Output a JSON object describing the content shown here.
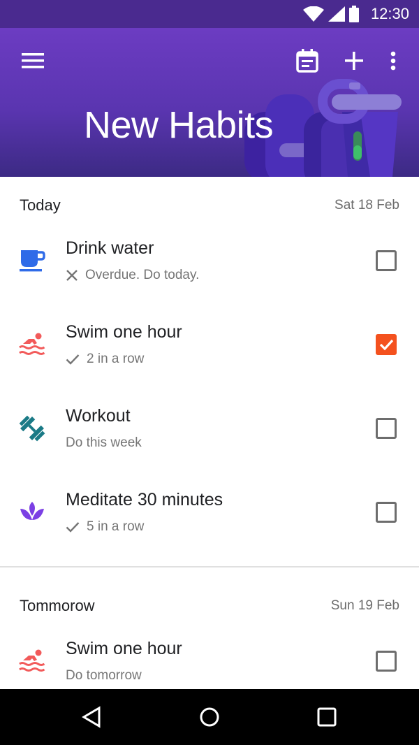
{
  "status_bar": {
    "time": "12:30"
  },
  "header": {
    "title": "New Habits",
    "icons": [
      "menu-icon",
      "calendar-icon",
      "add-icon",
      "more-vert-icon"
    ]
  },
  "sections": [
    {
      "label": "Today",
      "date": "Sat 18 Feb",
      "items": [
        {
          "name": "Drink water",
          "status": "Overdue. Do today.",
          "status_icon": "close",
          "checked": false,
          "icon": "coffee-cup-icon",
          "icon_color": "#2f6be8"
        },
        {
          "name": "Swim one hour",
          "status": "2 in a row",
          "status_icon": "check",
          "checked": true,
          "icon": "swimmer-icon",
          "icon_color": "#f25a5a"
        },
        {
          "name": "Workout",
          "status": "Do this week",
          "status_icon": "",
          "checked": false,
          "icon": "dumbbell-icon",
          "icon_color": "#1a7a86"
        },
        {
          "name": "Meditate 30 minutes",
          "status": "5 in a row",
          "status_icon": "check",
          "checked": false,
          "icon": "lotus-icon",
          "icon_color": "#7b3fe4"
        }
      ]
    },
    {
      "label": "Tommorow",
      "date": "Sun 19 Feb",
      "items": [
        {
          "name": "Swim one hour",
          "status": "Do tomorrow",
          "status_icon": "",
          "checked": false,
          "icon": "swimmer-icon",
          "icon_color": "#f25a5a"
        }
      ]
    }
  ],
  "colors": {
    "accent": "#f4511e",
    "header": "#5a35b0",
    "statusbar": "#4a2a8f"
  }
}
